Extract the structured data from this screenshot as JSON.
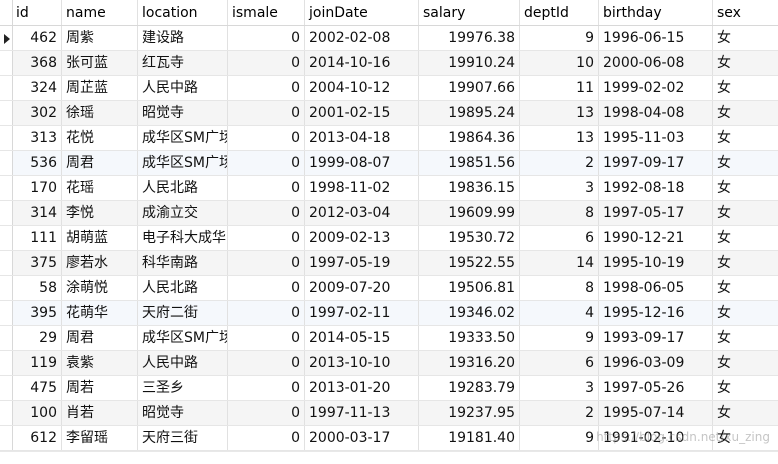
{
  "columns": [
    "id",
    "name",
    "location",
    "ismale",
    "joinDate",
    "salary",
    "deptId",
    "birthday",
    "sex"
  ],
  "rows": [
    [
      "462",
      "周紫",
      "建设路",
      "0",
      "2002-02-08",
      "19976.38",
      "9",
      "1996-06-15",
      "女"
    ],
    [
      "368",
      "张可蓝",
      "红瓦寺",
      "0",
      "2014-10-16",
      "19910.24",
      "10",
      "2000-06-08",
      "女"
    ],
    [
      "324",
      "周芷蓝",
      "人民中路",
      "0",
      "2004-10-12",
      "19907.66",
      "11",
      "1999-02-02",
      "女"
    ],
    [
      "302",
      "徐瑶",
      "昭觉寺",
      "0",
      "2001-02-15",
      "19895.24",
      "13",
      "1998-04-08",
      "女"
    ],
    [
      "313",
      "花悦",
      "成华区SM广场",
      "0",
      "2013-04-18",
      "19864.36",
      "13",
      "1995-11-03",
      "女"
    ],
    [
      "536",
      "周君",
      "成华区SM广场",
      "0",
      "1999-08-07",
      "19851.56",
      "2",
      "1997-09-17",
      "女"
    ],
    [
      "170",
      "花瑶",
      "人民北路",
      "0",
      "1998-11-02",
      "19836.15",
      "3",
      "1992-08-18",
      "女"
    ],
    [
      "314",
      "李悦",
      "成渝立交",
      "0",
      "2012-03-04",
      "19609.99",
      "8",
      "1997-05-17",
      "女"
    ],
    [
      "111",
      "胡萌蓝",
      "电子科大成华",
      "0",
      "2009-02-13",
      "19530.72",
      "6",
      "1990-12-21",
      "女"
    ],
    [
      "375",
      "廖若水",
      "科华南路",
      "0",
      "1997-05-19",
      "19522.55",
      "14",
      "1995-10-19",
      "女"
    ],
    [
      "58",
      "涂萌悦",
      "人民北路",
      "0",
      "2009-07-20",
      "19506.81",
      "8",
      "1998-06-05",
      "女"
    ],
    [
      "395",
      "花萌华",
      "天府二街",
      "0",
      "1997-02-11",
      "19346.02",
      "4",
      "1995-12-16",
      "女"
    ],
    [
      "29",
      "周君",
      "成华区SM广场",
      "0",
      "2014-05-15",
      "19333.50",
      "9",
      "1993-09-17",
      "女"
    ],
    [
      "119",
      "袁紫",
      "人民中路",
      "0",
      "2013-10-10",
      "19316.20",
      "6",
      "1996-03-09",
      "女"
    ],
    [
      "475",
      "周若",
      "三圣乡",
      "0",
      "2013-01-20",
      "19283.79",
      "3",
      "1997-05-26",
      "女"
    ],
    [
      "100",
      "肖若",
      "昭觉寺",
      "0",
      "1997-11-13",
      "19237.95",
      "2",
      "1995-07-14",
      "女"
    ],
    [
      "612",
      "李留瑶",
      "天府三街",
      "0",
      "2000-03-17",
      "19181.40",
      "9",
      "1991-02-10",
      "女"
    ]
  ],
  "watermark": "https://blog.csdn.net/xu_zing"
}
